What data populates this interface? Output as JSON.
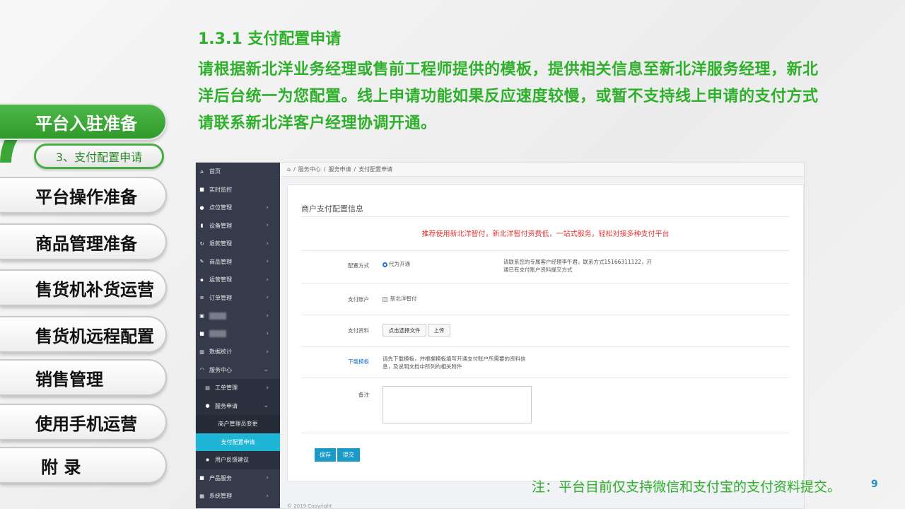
{
  "colors": {
    "accent_green": "#2fb02c",
    "nav_active": "#3aa635",
    "sidebar_bg": "#353b4a",
    "sidebar_selected": "#1fb5d6",
    "promo_red": "#e53935",
    "primary_button": "#1a9ac9"
  },
  "nav": {
    "items": [
      {
        "label": "平台入驻准备",
        "active": true
      },
      {
        "label": "平台操作准备"
      },
      {
        "label": "商品管理准备"
      },
      {
        "label": "售货机补货运营"
      },
      {
        "label": "售货机远程配置"
      },
      {
        "label": "销售管理"
      },
      {
        "label": "使用手机运营"
      },
      {
        "label": "附 录"
      }
    ],
    "sub_active": "3、支付配置申请"
  },
  "heading": {
    "title": "1.3.1 支付配置申请",
    "line1": "请根据新北洋业务经理或售前工程师提供的模板，提供相关信息至新北洋服务经理，新北",
    "line2": "洋后台统一为您配置。线上申请功能如果反应速度较慢，或暂不支持线上申请的支付方式",
    "line3": "请联系新北洋客户经理协调开通。"
  },
  "app": {
    "sidebar": [
      {
        "label": "首页",
        "icon": "home-icon"
      },
      {
        "label": "实时监控",
        "icon": "video-icon"
      },
      {
        "label": "点位管理",
        "icon": "map-pin-icon",
        "chevron": "›"
      },
      {
        "label": "设备管理",
        "icon": "device-icon",
        "chevron": "›"
      },
      {
        "label": "退款管理",
        "icon": "refund-icon",
        "chevron": "›"
      },
      {
        "label": "商品管理",
        "icon": "edit-icon",
        "chevron": "›"
      },
      {
        "label": "运营管理",
        "icon": "bookmark-icon",
        "chevron": "›"
      },
      {
        "label": "订单管理",
        "icon": "list-icon",
        "chevron": "›"
      },
      {
        "label": "",
        "icon": "blurred-icon",
        "chevron": "›",
        "blurred": true
      },
      {
        "label": "",
        "icon": "blurred-icon",
        "chevron": "›",
        "blurred": true
      },
      {
        "label": "数据统计",
        "icon": "chart-icon",
        "chevron": "›"
      },
      {
        "label": "服务中心",
        "icon": "headset-icon",
        "chevron": "⌄"
      },
      {
        "label": "工单管理",
        "icon": "ticket-icon",
        "chevron": "›",
        "level": 1
      },
      {
        "label": "服务申请",
        "icon": "user-icon",
        "chevron": "⌄",
        "level": 1
      },
      {
        "label": "商户管理员变更",
        "level": 2
      },
      {
        "label": "支付配置申请",
        "level": 2,
        "selected": true
      },
      {
        "label": "用户反馈建议",
        "icon": "settings-icon",
        "level": 1
      },
      {
        "label": "产品服务",
        "icon": "box-icon",
        "chevron": "›"
      },
      {
        "label": "系统管理",
        "icon": "grid-icon",
        "chevron": "›"
      }
    ],
    "breadcrumb": [
      "服务中心",
      "服务申请",
      "支付配置申请"
    ],
    "card_title": "商户支付配置信息",
    "promo": "推荐使用新北洋智付，新北洋智付资费低，一站式服务，轻松对接多种支付平台",
    "form": {
      "method_label": "配置方式",
      "method_value": "代为开通",
      "method_hint1": "请联系您的专属客户经理李午君，联系方式15166311122，开",
      "method_hint2": "通已有支付账户资料提交方式",
      "account_label": "支付账户",
      "account_value": "新北洋智付",
      "material_label": "支付资料",
      "choose_file": "点击选择文件",
      "upload": "上传",
      "download_label": "下载模板",
      "download_hint1": "请先下载模板，并根据模板填写开通支付账户所需要的资料信",
      "download_hint2": "息，及说明文档中所列的相关附件",
      "remark_label": "备注",
      "save": "保存",
      "submit": "提交"
    },
    "footer": "© 2019 Copyright"
  },
  "note": "注：平台目前仅支持微信和支付宝的支付资料提交。",
  "page_number": "9"
}
